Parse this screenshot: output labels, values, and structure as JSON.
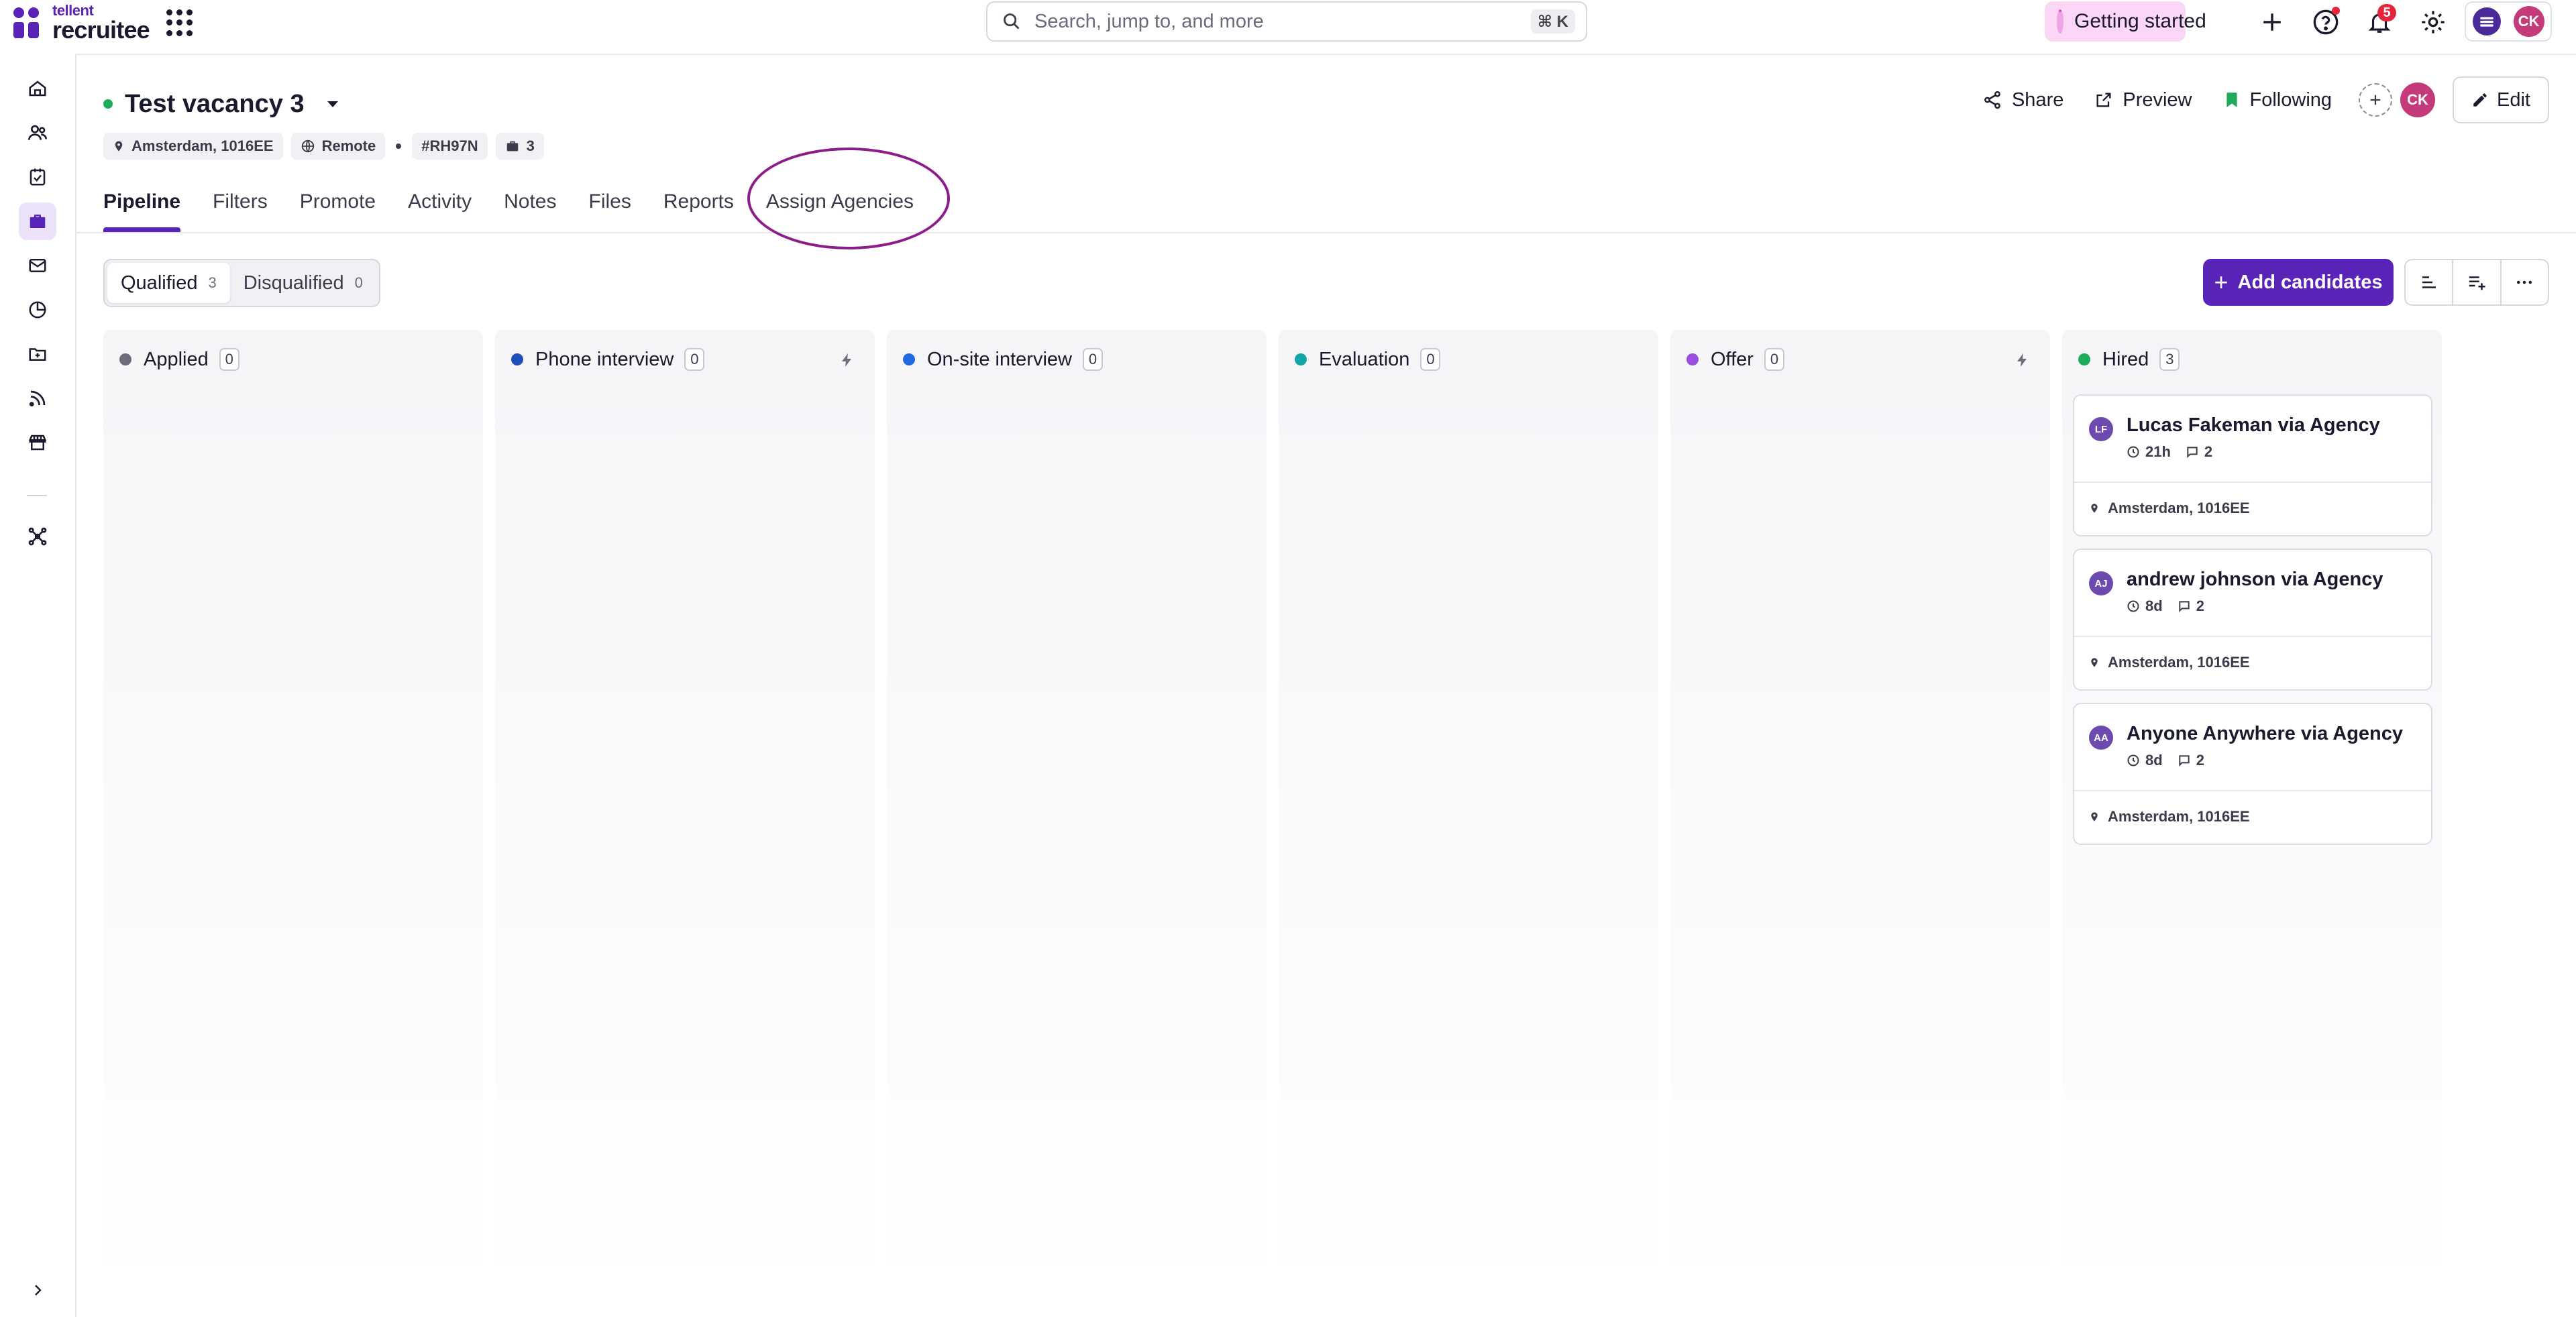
{
  "brand": {
    "line1": "tellent",
    "line2": "recruitee"
  },
  "search": {
    "placeholder": "Search, jump to, and more",
    "shortcut": "⌘ K"
  },
  "topbar": {
    "getting_started": "Getting started",
    "notifications_count": "5",
    "user_initials": "CK"
  },
  "sidebar": {
    "items": [
      "home-icon",
      "people-icon",
      "tasks-icon",
      "jobs-icon",
      "mail-icon",
      "reports-icon",
      "folder-icon",
      "feed-icon",
      "store-icon",
      "integrations-icon"
    ],
    "active": "jobs-icon"
  },
  "job": {
    "title": "Test vacancy 3",
    "status_color": "#1eac5b",
    "location": "Amsterdam, 1016EE",
    "remote": "Remote",
    "ref": "#RH97N",
    "openings": "3"
  },
  "actions": {
    "share": "Share",
    "preview": "Preview",
    "following": "Following",
    "follower_initials": "CK",
    "edit": "Edit"
  },
  "tabs": [
    {
      "label": "Pipeline",
      "active": true
    },
    {
      "label": "Filters"
    },
    {
      "label": "Promote"
    },
    {
      "label": "Activity"
    },
    {
      "label": "Notes"
    },
    {
      "label": "Files"
    },
    {
      "label": "Reports"
    },
    {
      "label": "Assign Agencies"
    }
  ],
  "filter": {
    "qualified_label": "Qualified",
    "qualified_count": "3",
    "disqualified_label": "Disqualified",
    "disqualified_count": "0"
  },
  "add_candidates": "Add candidates",
  "accent_color": "#5a23b7",
  "stages": [
    {
      "name": "Applied",
      "count": "0",
      "color": "#6b6b7b",
      "automation": false
    },
    {
      "name": "Phone interview",
      "count": "0",
      "color": "#1f4fb8",
      "automation": true
    },
    {
      "name": "On-site interview",
      "count": "0",
      "color": "#1f6ae0",
      "automation": false
    },
    {
      "name": "Evaluation",
      "count": "0",
      "color": "#14a6a6",
      "automation": false
    },
    {
      "name": "Offer",
      "count": "0",
      "color": "#9b4fe0",
      "automation": true
    },
    {
      "name": "Hired",
      "count": "3",
      "color": "#1eac5b",
      "automation": false
    }
  ],
  "hired_candidates": [
    {
      "initials": "LF",
      "name": "Lucas Fakeman via Agency",
      "time": "21h",
      "comments": "2",
      "location": "Amsterdam, 1016EE"
    },
    {
      "initials": "AJ",
      "name": "andrew johnson via Agency",
      "time": "8d",
      "comments": "2",
      "location": "Amsterdam, 1016EE"
    },
    {
      "initials": "AA",
      "name": "Anyone Anywhere via Agency",
      "time": "8d",
      "comments": "2",
      "location": "Amsterdam, 1016EE"
    }
  ]
}
